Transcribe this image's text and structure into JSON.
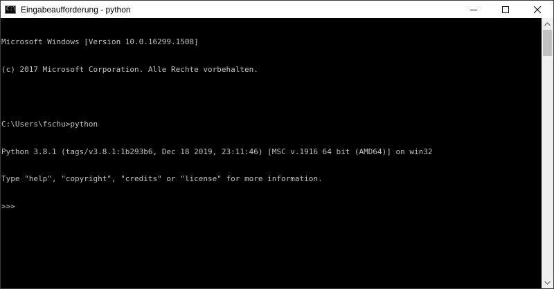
{
  "window": {
    "title": "Eingabeaufforderung - python",
    "icon": "cmd-icon",
    "controls": [
      "minimize-icon",
      "maximize-icon",
      "close-icon"
    ]
  },
  "console": {
    "lines": [
      "Microsoft Windows [Version 10.0.16299.1508]",
      "(c) 2017 Microsoft Corporation. Alle Rechte vorbehalten.",
      "",
      "C:\\Users\\fschu>python",
      "Python 3.8.1 (tags/v3.8.1:1b293b6, Dec 18 2019, 23:11:46) [MSC v.1916 64 bit (AMD64)] on win32",
      "Type \"help\", \"copyright\", \"credits\" or \"license\" for more information.",
      ">>> "
    ],
    "colors": {
      "background": "#000000",
      "foreground": "#c0c0c0"
    }
  }
}
